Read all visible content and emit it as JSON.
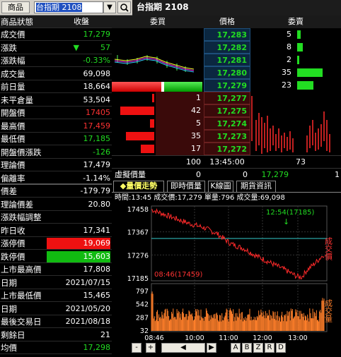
{
  "topbar": {
    "product_btn": "商品",
    "symbol": "台指期 2108",
    "dropdown": "▼",
    "title": "台指期 2108"
  },
  "quote_header": {
    "label": "商品狀態",
    "value": "收盤"
  },
  "quotes": [
    {
      "label": "成交價",
      "value": "17,279",
      "color": "#22dd22"
    },
    {
      "label": "漲跌",
      "value": "57",
      "color": "#22dd22",
      "arrow": "▼"
    },
    {
      "label": "漲跌幅",
      "value": "-0.33%",
      "color": "#22dd22"
    },
    {
      "label": "成交量",
      "value": "69,098",
      "color": "#ffffff"
    },
    {
      "label": "前日量",
      "value": "18,664",
      "color": "#ffffff"
    },
    {
      "label": "未平倉量",
      "value": "53,504",
      "color": "#ffffff"
    },
    {
      "label": "開盤價",
      "value": "17405",
      "color": "#ff3333"
    },
    {
      "label": "最高價",
      "value": "17,459",
      "color": "#ff3333"
    },
    {
      "label": "最低價",
      "value": "17,185",
      "color": "#22dd22"
    },
    {
      "label": "開盤價漲跌",
      "value": "-126",
      "color": "#22dd22"
    },
    {
      "label": "理論價",
      "value": "17,479",
      "color": "#ffffff"
    },
    {
      "label": "偏離率",
      "value": "-1.14%",
      "color": "#ffffff"
    }
  ],
  "quotes2": [
    {
      "label": "價差",
      "value": "-179.79",
      "color": "#ffffff"
    },
    {
      "label": "理論價差",
      "value": "20.80",
      "color": "#ffffff"
    },
    {
      "label": "漲跌幅調整",
      "value": "",
      "color": "#ffffff"
    },
    {
      "label": "昨日收",
      "value": "17,341",
      "color": "#ffffff"
    },
    {
      "label": "漲停價",
      "value": "19,069",
      "color": "#ffffff",
      "bg": "#ee1111"
    },
    {
      "label": "跌停價",
      "value": "15,603",
      "color": "#ffffff",
      "bg": "#11bb11"
    },
    {
      "label": "上市最高價",
      "value": "17,808",
      "color": "#ffffff"
    },
    {
      "label": "日期",
      "value": "2021/07/15",
      "color": "#ffffff"
    },
    {
      "label": "上市最低價",
      "value": "15,465",
      "color": "#ffffff"
    },
    {
      "label": "日期",
      "value": "2021/05/20",
      "color": "#ffffff"
    },
    {
      "label": "最後交易日",
      "value": "2021/08/18",
      "color": "#ffffff"
    },
    {
      "label": "剩餘日",
      "value": "21",
      "color": "#ffffff"
    },
    {
      "label": "均價",
      "value": "17,298",
      "color": "#22dd22"
    }
  ],
  "orderbook": {
    "headers": {
      "bid": "委買",
      "price": "價格",
      "ask": "委賣"
    },
    "asks": [
      {
        "price": "17,283",
        "qty": "5",
        "bar": 0.06
      },
      {
        "price": "17,282",
        "qty": "8",
        "bar": 0.09
      },
      {
        "price": "17,281",
        "qty": "2",
        "bar": 0.03
      },
      {
        "price": "17,280",
        "qty": "35",
        "bar": 0.4
      },
      {
        "price": "17,279",
        "qty": "23",
        "bar": 0.26
      }
    ],
    "bids": [
      {
        "price": "17,277",
        "qty": "1",
        "bar": 0.02
      },
      {
        "price": "17,275",
        "qty": "42",
        "bar": 0.48
      },
      {
        "price": "17,274",
        "qty": "5",
        "bar": 0.06
      },
      {
        "price": "17,273",
        "qty": "35",
        "bar": 0.4
      },
      {
        "price": "17,272",
        "qty": "17",
        "bar": 0.19
      }
    ],
    "totals": {
      "bid": "100",
      "time": "13:45:00",
      "ask": "73"
    },
    "sim": {
      "label": "虛擬價量",
      "v1": "0",
      "v2": "0",
      "price": "17,279",
      "v3": "1"
    }
  },
  "tabs": [
    "◆量價走勢",
    "即時價量",
    "K線圖",
    "期貨資訊"
  ],
  "chart_info": "時間:13:45 成交價:17,279 單量:796 成交量:69,098",
  "chart": {
    "price_ticks": [
      "17458",
      "17367",
      "17276",
      "17185"
    ],
    "vol_ticks": [
      "797",
      "542",
      "287",
      "32"
    ],
    "time_ticks": [
      "08:46",
      "10:00",
      "11:00",
      "12:00",
      "13:00"
    ],
    "annot_high": "12:54(17185)",
    "annot_low": "08:46(17459)",
    "right_price_label": "成交價",
    "right_vol_label": "成交量"
  },
  "chart_data": {
    "type": "line",
    "title": "",
    "xlabel": "",
    "ylabel": "成交價",
    "x": [
      "08:46",
      "10:00",
      "11:00",
      "12:00",
      "12:54",
      "13:00",
      "13:45"
    ],
    "series": [
      {
        "name": "成交價",
        "values": [
          17459,
          17380,
          17310,
          17260,
          17185,
          17250,
          17279
        ]
      }
    ],
    "reference_line": 17341,
    "ylim": [
      17185,
      17458
    ]
  },
  "bottom_buttons": [
    "-",
    "+",
    "◀",
    "▶",
    "A",
    "B",
    "Z",
    "R",
    "D"
  ],
  "colors": {
    "up": "#ff3333",
    "down": "#22dd22",
    "price_line": "#ff2a2a",
    "vol_bar": "#ff7f2a",
    "ref_line": "#33cccc"
  }
}
